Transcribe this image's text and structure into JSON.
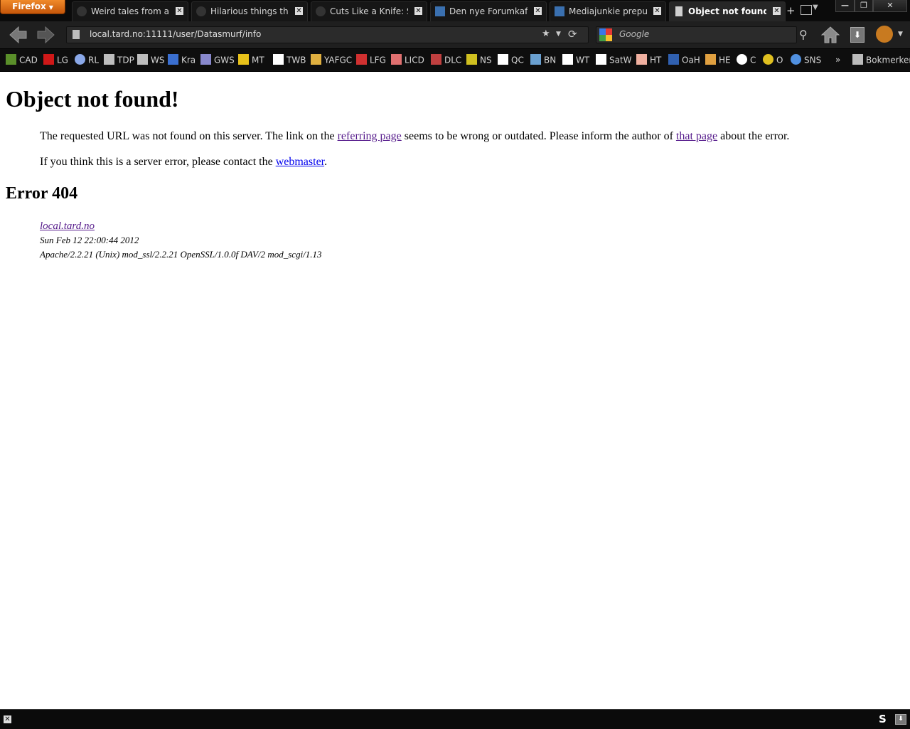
{
  "browser": {
    "menu_button": "Firefox",
    "tabs": [
      {
        "label": "Weird tales from ar...",
        "icon": "dark-silhouette-icon",
        "active": false
      },
      {
        "label": "Hilarious things tha...",
        "icon": "dark-silhouette-icon",
        "active": false
      },
      {
        "label": "Cuts Like a Knife: S...",
        "icon": "dark-silhouette-icon",
        "active": false
      },
      {
        "label": "Den nye Forumkafé...",
        "icon": "y-logo-icon",
        "active": false
      },
      {
        "label": "Mediajunkie prepu...",
        "icon": "y-logo-icon",
        "active": false
      },
      {
        "label": "Object not found!",
        "icon": "page-icon",
        "active": true
      }
    ],
    "tab_close": "✕",
    "new_tab": "+",
    "window_controls": {
      "minimize": "—",
      "maximize": "❐",
      "close": "✕"
    },
    "url": "local.tard.no:11111/user/Datasmurf/info",
    "search_placeholder": "Google",
    "bookmarks": [
      {
        "label": "CAD",
        "icon": "cad-icon",
        "color": "#5a8f2a"
      },
      {
        "label": "LG",
        "icon": "heart-icon",
        "color": "#d01818"
      },
      {
        "label": "RL",
        "icon": "ellipse-icon",
        "color": "#8aa8e8"
      },
      {
        "label": "TDP",
        "icon": "page-icon",
        "color": "#bdbdbd"
      },
      {
        "label": "WS",
        "icon": "page-icon",
        "color": "#bdbdbd"
      },
      {
        "label": "Kra",
        "icon": "kra-icon",
        "color": "#3a6fd0"
      },
      {
        "label": "GWS",
        "icon": "gws-icon",
        "color": "#8888cc"
      },
      {
        "label": "MT",
        "icon": "mt-icon",
        "color": "#e8c21a"
      },
      {
        "label": "TWB",
        "icon": "twb-icon",
        "color": "#ffffff"
      },
      {
        "label": "YAFGC",
        "icon": "yafgc-icon",
        "color": "#e0b040"
      },
      {
        "label": "LFG",
        "icon": "lfg-icon",
        "color": "#d03030"
      },
      {
        "label": "LICD",
        "icon": "licd-icon",
        "color": "#e07070"
      },
      {
        "label": "DLC",
        "icon": "dlc-icon",
        "color": "#c04040"
      },
      {
        "label": "NS",
        "icon": "ns-icon",
        "color": "#d0c020"
      },
      {
        "label": "QC",
        "icon": "qc-icon",
        "color": "#ffffff"
      },
      {
        "label": "BN",
        "icon": "bn-icon",
        "color": "#6aa0d0"
      },
      {
        "label": "WT",
        "icon": "wt-icon",
        "color": "#ffffff"
      },
      {
        "label": "SatW",
        "icon": "satw-icon",
        "color": "#ffffff"
      },
      {
        "label": "HT",
        "icon": "ht-icon",
        "color": "#f0b0a0"
      },
      {
        "label": "OaH",
        "icon": "oah-icon",
        "color": "#3060b0"
      },
      {
        "label": "HE",
        "icon": "he-icon",
        "color": "#e0a040"
      },
      {
        "label": "C",
        "icon": "skull-icon",
        "color": "#ffffff"
      },
      {
        "label": "O",
        "icon": "eye-icon",
        "color": "#e0c020"
      },
      {
        "label": "SNS",
        "icon": "sns-icon",
        "color": "#5090e0"
      }
    ],
    "bookmarks_overflow": "»",
    "bookmarks_menu": "Bokmerker",
    "status_addon": "S"
  },
  "page": {
    "title": "Object not found!",
    "p1_before": "The requested URL was not found on this server. The link on the ",
    "p1_link1": "referring page",
    "p1_mid": " seems to be wrong or outdated. Please inform the author of ",
    "p1_link2": "that page",
    "p1_after": " about the error.",
    "p2_before": "If you think this is a server error, please contact the ",
    "p2_link": "webmaster",
    "p2_after": ".",
    "error_heading": "Error 404",
    "server_host": "local.tard.no",
    "timestamp": "Sun Feb 12 22:00:44 2012",
    "server_signature": "Apache/2.2.21 (Unix) mod_ssl/2.2.21 OpenSSL/1.0.0f DAV/2 mod_scgi/1.13"
  }
}
